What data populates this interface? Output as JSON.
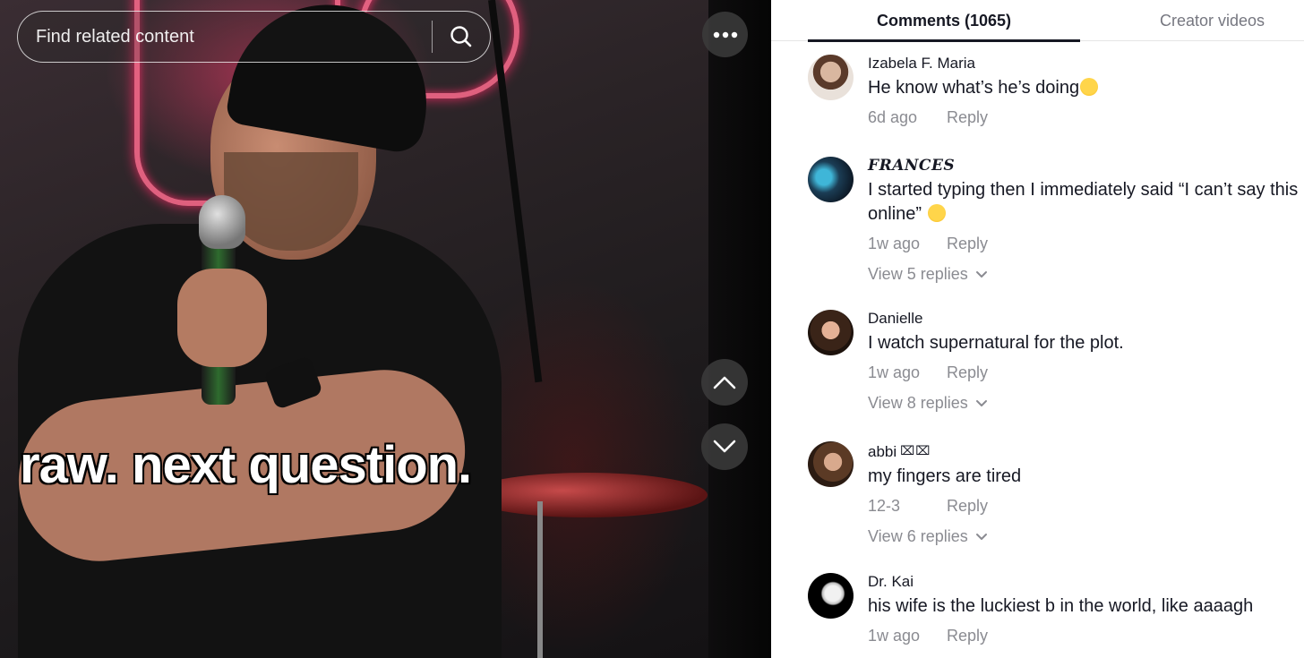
{
  "search": {
    "placeholder": "Find related content"
  },
  "video": {
    "caption": "raw. next question."
  },
  "tabs": {
    "comments_label": "Comments (1065)",
    "creator_label": "Creator videos"
  },
  "icons": {
    "search": "search-icon",
    "more": "more-horizontal-icon",
    "up": "chevron-up-icon",
    "down": "chevron-down-icon"
  },
  "comments": [
    {
      "username": "Izabela F. Maria",
      "text": "He know what’s he’s doing",
      "emoji": "grinning-sweat-emoji",
      "time": "6d ago",
      "reply": "Reply"
    },
    {
      "username": "𝑭𝑹𝑨𝑵𝑪𝑬𝑺",
      "text": "I started typing then I immediately said “I can’t say this online”",
      "emoji": "loudly-crying-emoji",
      "time": "1w ago",
      "reply": "Reply",
      "view_replies": "View 5 replies"
    },
    {
      "username": "Danielle",
      "text": "I watch supernatural for the plot.",
      "time": "1w ago",
      "reply": "Reply",
      "view_replies": "View 8 replies"
    },
    {
      "username": "abbi",
      "username_suffix": "⌧⌧",
      "text": "my fingers are tired",
      "time": "12-3",
      "reply": "Reply",
      "view_replies": "View 6 replies"
    },
    {
      "username": "Dr. Kai",
      "text": "his wife is the luckiest b in the world, like aaaagh",
      "time": "1w ago",
      "reply": "Reply"
    }
  ],
  "colors": {
    "text_primary": "#161823",
    "text_secondary": "#8a8b91",
    "tab_inactive": "#767780"
  }
}
